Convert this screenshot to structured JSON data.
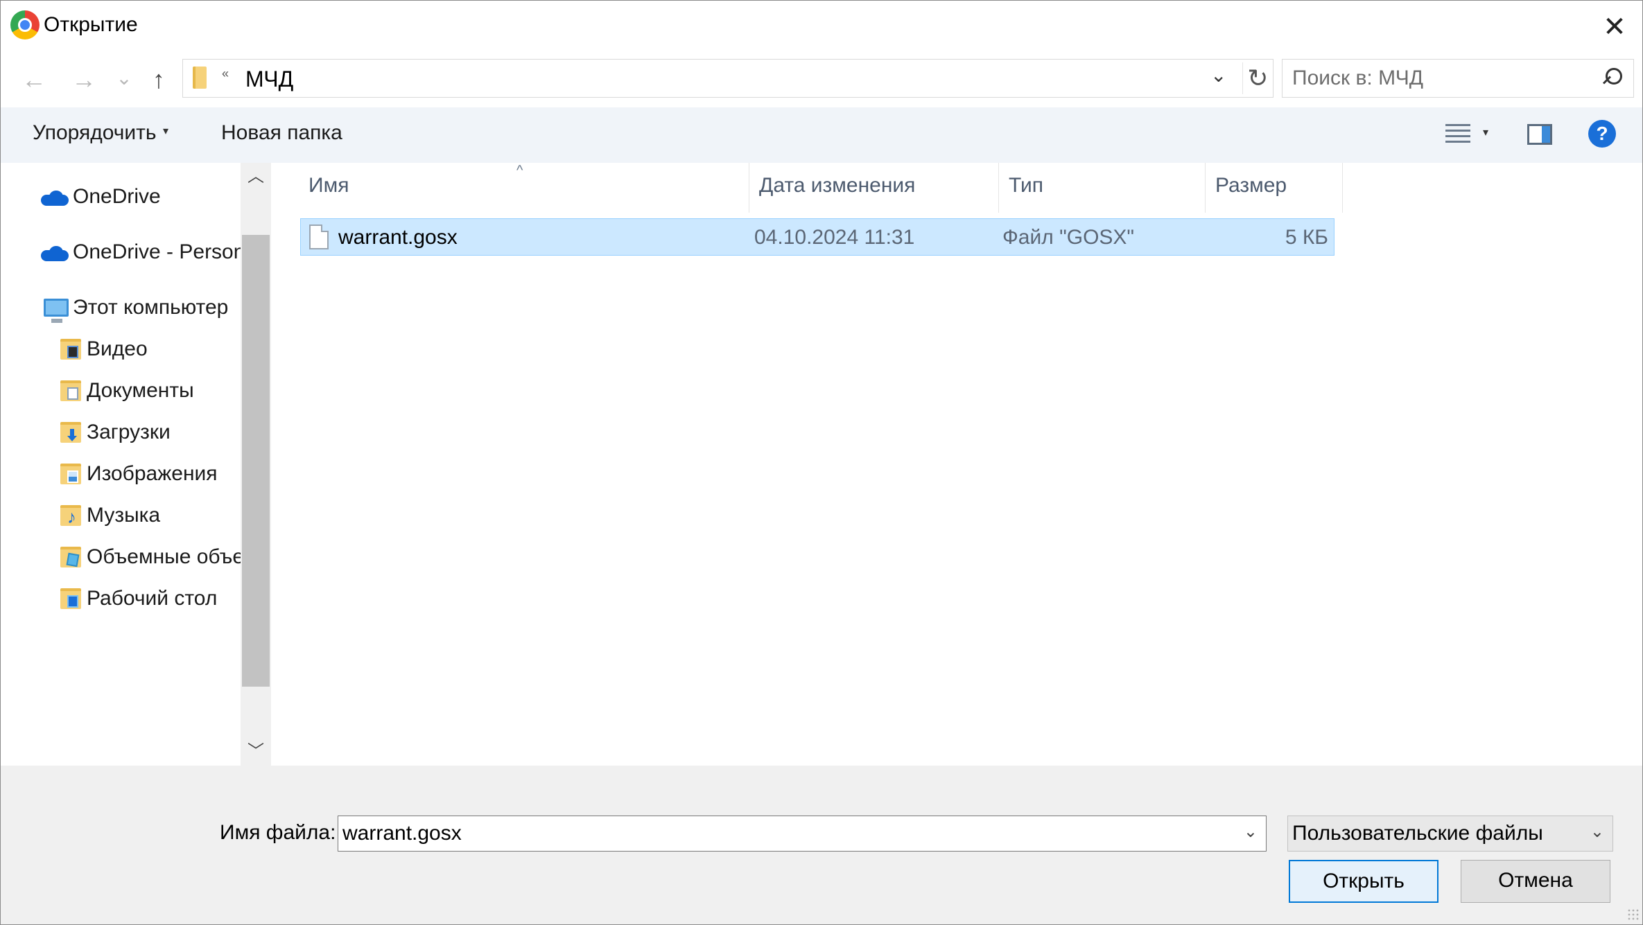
{
  "window": {
    "title": "Открытие",
    "close_glyph": "✕"
  },
  "nav": {
    "back_glyph": "←",
    "forward_glyph": "→",
    "recent_glyph": "⌄",
    "up_glyph": "↑",
    "address_chevron": "«",
    "address": "МЧД",
    "address_drop_glyph": "⌄",
    "refresh_glyph": "↻",
    "search_placeholder": "Поиск в: МЧД"
  },
  "toolbar": {
    "organize_label": "Упорядочить",
    "organize_caret": "▾",
    "new_folder_label": "Новая папка",
    "view_caret": "▾",
    "help_glyph": "?"
  },
  "sidebar": {
    "items": [
      {
        "label": "OneDrive",
        "icon": "cloud-icon"
      },
      {
        "label": "OneDrive - Person",
        "icon": "cloud-icon"
      },
      {
        "label": "Этот компьютер",
        "icon": "computer-icon"
      },
      {
        "label": "Видео",
        "icon": "video-folder-icon"
      },
      {
        "label": "Документы",
        "icon": "documents-folder-icon"
      },
      {
        "label": "Загрузки",
        "icon": "downloads-folder-icon"
      },
      {
        "label": "Изображения",
        "icon": "pictures-folder-icon"
      },
      {
        "label": "Музыка",
        "icon": "music-folder-icon"
      },
      {
        "label": "Объемные объе",
        "icon": "3d-objects-folder-icon"
      },
      {
        "label": "Рабочий стол",
        "icon": "desktop-folder-icon"
      }
    ],
    "scroll_up_glyph": "︿",
    "scroll_down_glyph": "﹀"
  },
  "filelist": {
    "sort_glyph": "^",
    "columns": {
      "name": "Имя",
      "date": "Дата изменения",
      "type": "Тип",
      "size": "Размер"
    },
    "rows": [
      {
        "name": "warrant.gosx",
        "date": "04.10.2024 11:31",
        "type": "Файл \"GOSX\"",
        "size": "5 КБ",
        "selected": true
      }
    ]
  },
  "footer": {
    "filename_label": "Имя файла:",
    "filename_value": "warrant.gosx",
    "filename_drop_glyph": "⌄",
    "filetype_value": "Пользовательские файлы",
    "filetype_drop_glyph": "⌄",
    "open_label": "Открыть",
    "cancel_label": "Отмена"
  },
  "colors": {
    "accent": "#0078d7",
    "selection": "#cce8ff",
    "toolbar_bg": "#f0f4f9",
    "footer_bg": "#f0f0f0"
  }
}
